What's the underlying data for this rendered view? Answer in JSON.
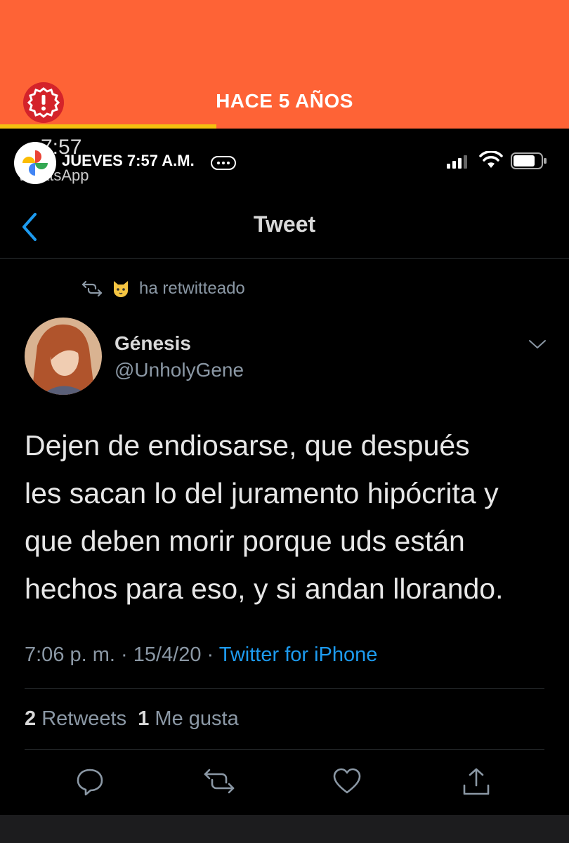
{
  "story": {
    "title": "HACE 5 AÑOS",
    "progress": 0.38,
    "accent_color": "#fe6336",
    "alert_icon": "alert-icon"
  },
  "status_bar": {
    "ghost_time": "7:57",
    "ghost_app": "WhatsApp",
    "date": "JUEVES 7:57 A.M.",
    "icons": [
      "signal-icon",
      "wifi-icon",
      "battery-icon"
    ]
  },
  "nav": {
    "title": "Tweet",
    "back_icon": "chevron-left-icon"
  },
  "tweet": {
    "retweet_label": "ha retwitteado",
    "author_name": "Génesis",
    "author_handle": "@UnholyGene",
    "lines": [
      "Dejen de endiosarse, que después",
      "les sacan lo del juramento hipócrita y",
      "que deben morir porque uds están",
      "hechos para eso, y si andan llorando."
    ],
    "time": "7:06 p. m. · 15/4/20 · ",
    "source": "Twitter for iPhone",
    "retweets_count": "2",
    "retweets_label": "Retweets",
    "likes_count": "1",
    "likes_label": "Me gusta",
    "link_color": "#1d9bf0"
  },
  "actions": [
    "reply-icon",
    "retweet-icon",
    "like-icon",
    "share-icon"
  ]
}
